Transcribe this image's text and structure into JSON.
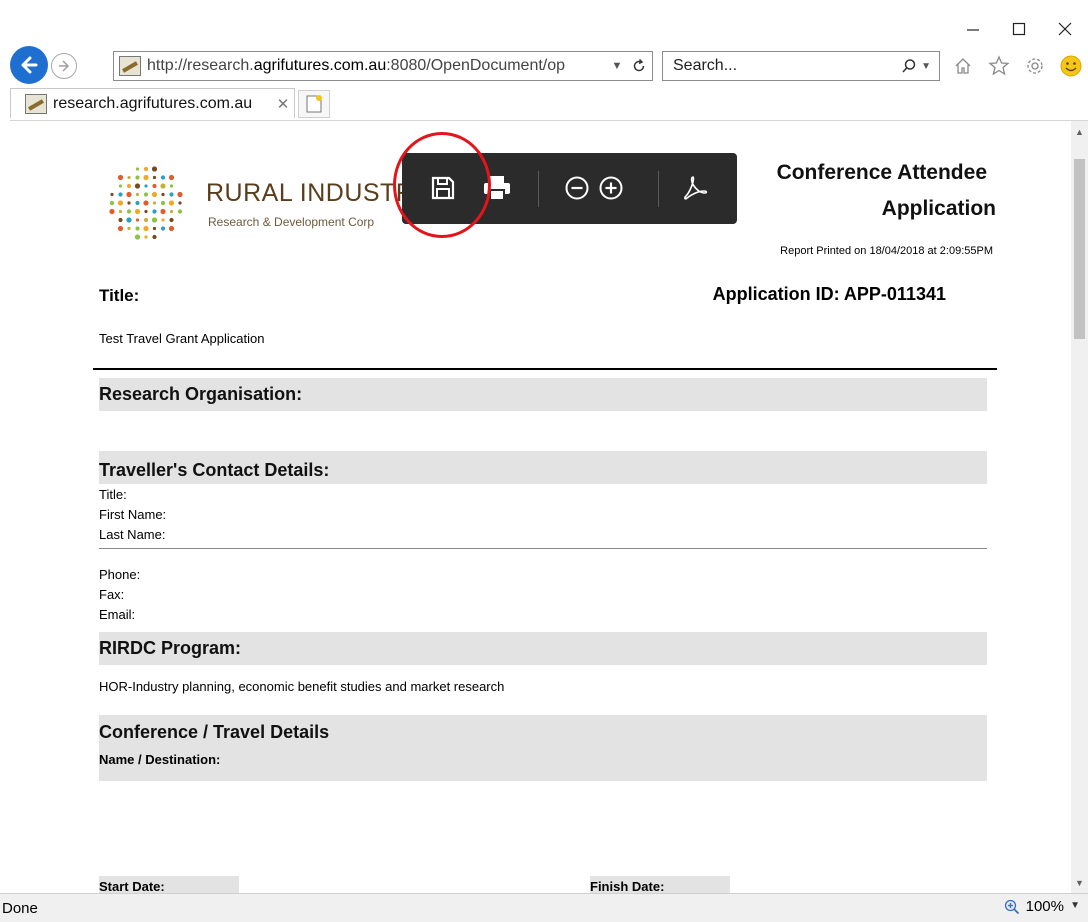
{
  "browser": {
    "address": {
      "prefix": "http://research.",
      "domain": "agrifutures.com.au",
      "suffix": ":8080/OpenDocument/op"
    },
    "search_placeholder": "Search...",
    "tab_label": "research.agrifutures.com.au",
    "status": "Done",
    "zoom": "100%",
    "accent": "#1f6fd1"
  },
  "toolbar": {
    "buttons": [
      "save-icon",
      "print-icon",
      "zoom-out-icon",
      "zoom-in-icon",
      "pdf-icon"
    ],
    "highlight_color": "#e3141b"
  },
  "report": {
    "logo_name": "RURAL INDUSTR",
    "logo_sub": "Research & Development Corp",
    "title_line1": "Conference Attendee",
    "title_line2": "Application",
    "printed": "Report Printed on 18/04/2018 at  2:09:55PM",
    "title_label": "Title:",
    "application_id": "Application ID: APP-011341",
    "title_value": "Test Travel Grant Application",
    "sections": {
      "research_org": "Research Organisation:",
      "contact": "Traveller's Contact Details:",
      "program": "RIRDC Program:",
      "travel": "Conference / Travel Details"
    },
    "contact_fields": [
      "Title:",
      "First Name:",
      "Last Name:"
    ],
    "contact_fields2": [
      "Phone:",
      "Fax:",
      "Email:"
    ],
    "program_value": "HOR-Industry planning, economic benefit studies and market research",
    "name_destination": "Name / Destination:",
    "start_date": "Start Date:",
    "finish_date": "Finish Date:"
  }
}
